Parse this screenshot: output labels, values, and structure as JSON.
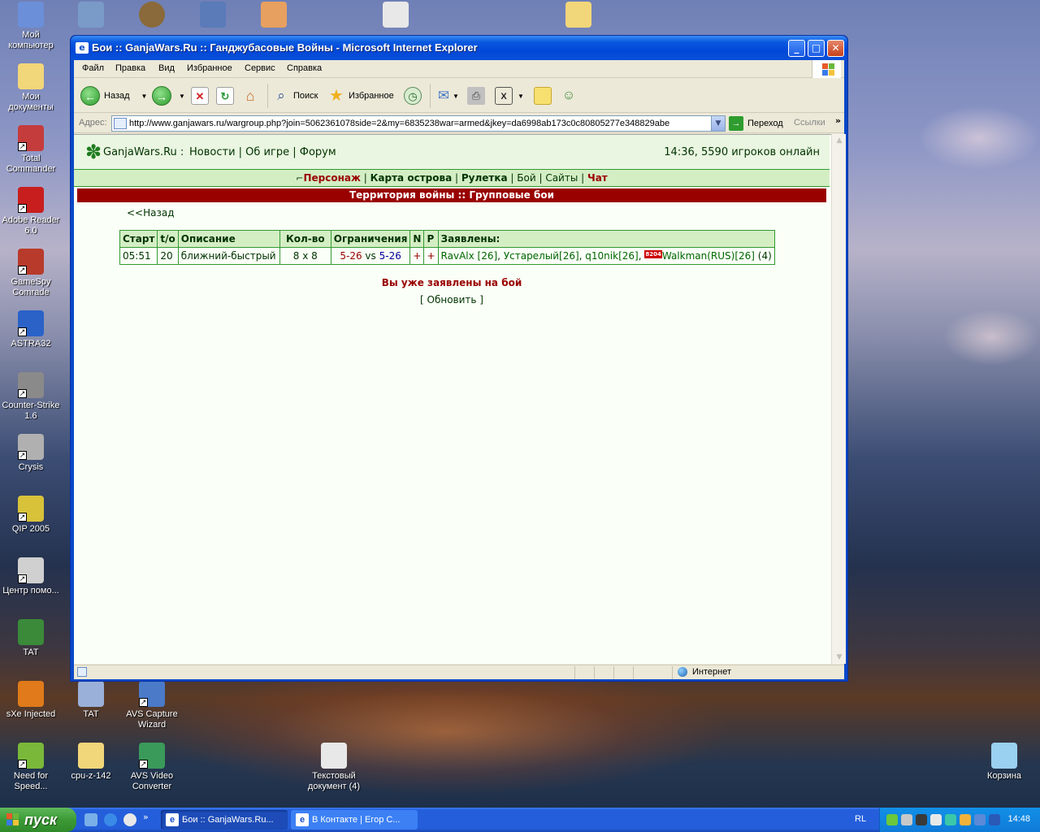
{
  "desktop_icons": [
    {
      "label": "Мой компьютер",
      "icon": "my-computer-icon",
      "color": "#6b8fd8"
    },
    {
      "label": "Мои документы",
      "icon": "my-documents-icon",
      "color": "#f2d67a"
    },
    {
      "label": "Total Commander",
      "icon": "total-commander-icon",
      "color": "#c53c3c"
    },
    {
      "label": "Adobe Reader 6.0",
      "icon": "adobe-reader-icon",
      "color": "#c81e1e"
    },
    {
      "label": "GameSpy Comrade",
      "icon": "gamespy-icon",
      "color": "#b83a2a"
    },
    {
      "label": "ASTRA32",
      "icon": "astra32-icon",
      "color": "#2a62c8"
    },
    {
      "label": "Counter-Strike 1.6",
      "icon": "counter-strike-icon",
      "color": "#8a8a8a"
    },
    {
      "label": "Crysis",
      "icon": "crysis-icon",
      "color": "#b0b0b0"
    },
    {
      "label": "QIP 2005",
      "icon": "qip-icon",
      "color": "#d8c23a"
    },
    {
      "label": "Центр помо...",
      "icon": "help-center-icon",
      "color": "#d0d0d0"
    },
    {
      "label": "TAT",
      "icon": "tat-icon",
      "color": "#3a8a3a"
    },
    {
      "label": "sXe Injected",
      "icon": "sxe-injected-icon",
      "color": "#e07a1a"
    },
    {
      "label": "TAT",
      "icon": "tat-icon-2",
      "color": "#9ab0d8"
    },
    {
      "label": "AVS Capture Wizard",
      "icon": "avs-capture-icon",
      "color": "#4a7ac8"
    },
    {
      "label": "Need for Speed...",
      "icon": "nfs-icon",
      "color": "#7ab83a"
    },
    {
      "label": "cpu-z-142",
      "icon": "folder-icon",
      "color": "#f2d67a"
    },
    {
      "label": "AVS Video Converter",
      "icon": "avs-video-icon",
      "color": "#3a9a5a"
    },
    {
      "label": "Текстовый документ (4)",
      "icon": "text-document-icon",
      "color": "#e8e8e8"
    },
    {
      "label": "Корзина",
      "icon": "recycle-bin-icon",
      "color": "#9ad0f0"
    }
  ],
  "window": {
    "title": "Бои :: GanjaWars.Ru :: Ганджубасовые Войны - Microsoft Internet Explorer",
    "menu": [
      "Файл",
      "Правка",
      "Вид",
      "Избранное",
      "Сервис",
      "Справка"
    ],
    "toolbar": {
      "back": "Назад",
      "search": "Поиск",
      "favorites": "Избранное"
    },
    "address_label": "Адрес:",
    "url": "http://www.ganjawars.ru/wargroup.php?join=5062361078side=2&my=6835238war=armed&jkey=da6998ab173c0c80805277e348829abe",
    "go": "Переход",
    "links": "Ссылки",
    "status_zone": "Интернет"
  },
  "page": {
    "site_name": "GanjaWars.Ru",
    "nav": [
      "Новости",
      "Об игре",
      "Форум"
    ],
    "online": "14:36, 5590 игроков онлайн",
    "menu": {
      "personage": "Персонаж",
      "map": "Карта острова",
      "roulette": "Рулетка",
      "fight": "Бой",
      "sites": "Сайты",
      "chat": "Чат"
    },
    "banner": "Территория войны :: Групповые бои",
    "back": "<<Назад",
    "table": {
      "headers": [
        "Старт",
        "t/o",
        "Описание",
        "Кол-во",
        "Ограничения",
        "N",
        "P",
        "Заявлены:"
      ],
      "row": {
        "start": "05:51",
        "timeout": "20",
        "description": "ближний-быстрый",
        "count": "8 x 8",
        "limit_left": "5-26",
        "vs": "vs",
        "limit_right": "5-26",
        "n": "+",
        "p": "+",
        "players": [
          "RavAlx [26]",
          "Устарелый[26]",
          "q10nik[26]",
          "Walkman(RUS)[26]"
        ],
        "badge": "8204",
        "total": "(4)"
      }
    },
    "already": "Вы уже заявлены на бой",
    "refresh": "[ Обновить ]"
  },
  "taskbar": {
    "start": "пуск",
    "tasks": [
      "Бои :: GanjaWars.Ru...",
      "В Контакте | Егор С..."
    ],
    "lang": "RL",
    "clock": "14:48"
  }
}
